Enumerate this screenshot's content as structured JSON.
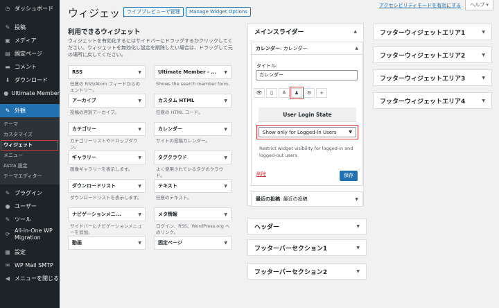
{
  "sidebar": {
    "dashboard": {
      "icon": "◷",
      "label": "ダッシュボード"
    },
    "posts": {
      "icon": "✎",
      "label": "投稿"
    },
    "media": {
      "icon": "▣",
      "label": "メディア"
    },
    "pages": {
      "icon": "▤",
      "label": "固定ページ"
    },
    "comments": {
      "icon": "▬",
      "label": "コメント"
    },
    "download": {
      "icon": "⬇",
      "label": "ダウンロード"
    },
    "um": {
      "icon": "●",
      "label": "Ultimate Member"
    },
    "appearance": {
      "icon": "✎",
      "label": "外観"
    },
    "sub": {
      "theme": "テーマ",
      "customize": "カスタマイズ",
      "widgets": "ウィジェット",
      "menus": "メニュー",
      "astra": "Astra 設定",
      "theme_editor": "テーマエディター"
    },
    "plugins": {
      "icon": "✎",
      "label": "プラグイン"
    },
    "users": {
      "icon": "●",
      "label": "ユーザー"
    },
    "tools": {
      "icon": "✎",
      "label": "ツール"
    },
    "aiowpm": {
      "icon": "⟳",
      "label1": "All-in-One WP",
      "label2": "Migration"
    },
    "settings": {
      "icon": "▦",
      "label": "設定"
    },
    "smtp": {
      "icon": "✉",
      "label": "WP Mail SMTP"
    },
    "collapse": {
      "icon": "◀",
      "label": "メニューを閉じる"
    }
  },
  "screen": {
    "a11y": "アクセシビリティモードを有効にする",
    "help": "ヘルプ ▾"
  },
  "header": {
    "title": "ウィジェット",
    "live_preview": "ライブプレビューで管理",
    "manage": "Manage Widget Options"
  },
  "available": {
    "title": "利用できるウィジェット",
    "desc": "ウィジェットを有効化するにはサイドバーにドラッグするかクリックしてください。ウィジェットを無効化し設定を削除したい場合は、ドラッグして元の場所に戻してください。",
    "widgets": [
      {
        "name": "RSS",
        "desc": "任意の RSS/Atom フィードからのエントリー。"
      },
      {
        "name": "Ultimate Member - ...",
        "desc": "Shows the search member form."
      },
      {
        "name": "アーカイブ",
        "desc": "投稿の月別アーカイブ。"
      },
      {
        "name": "カスタム HTML",
        "desc": "任意の HTML コード。"
      },
      {
        "name": "カテゴリー",
        "desc": "カテゴリーリストやドロップダウン。"
      },
      {
        "name": "カレンダー",
        "desc": "サイトの投稿カレンダー。"
      },
      {
        "name": "ギャラリー",
        "desc": "画像ギャラリーを表示します。"
      },
      {
        "name": "タグクラウド",
        "desc": "よく使用されているタグのクラウド。"
      },
      {
        "name": "ダウンロードリスト",
        "desc": "ダウンロードリストを表示します。"
      },
      {
        "name": "テキスト",
        "desc": "任意のテキスト。"
      },
      {
        "name": "ナビゲーションメニ...",
        "desc": "サイドバーにナビゲーションメニューを追加。"
      },
      {
        "name": "メタ情報",
        "desc": "ログイン、RSS、WordPress.org へのリンク。"
      },
      {
        "name": "動画",
        "desc": ""
      },
      {
        "name": "固定ページ",
        "desc": ""
      }
    ]
  },
  "main_slider": {
    "title": "メインスライダー",
    "widget_name": "カレンダー",
    "widget_sub": ": カレンダー",
    "title_label": "タイトル:",
    "title_value": "カレンダー",
    "tabs": [
      "👁",
      "▯",
      "≛",
      "♟",
      "⚙",
      "+"
    ],
    "uls_header": "User Login State",
    "select_value": "Show only for Logged-In Users",
    "help": "Restrict widget visibility for logged-in and logged-out users.",
    "delete": "削除",
    "save": "保存",
    "recent_name": "最近の投稿",
    "recent_sub": ": 最近の投稿"
  },
  "areas": {
    "header": "ヘッダー",
    "footer_bar1": "フッターバーセクション1",
    "footer_bar2": "フッターバーセクション2",
    "footer1": "フッターウィジェットエリア1",
    "footer2": "フッターウィジェットエリア2",
    "footer3": "フッターウィジェットエリア3",
    "footer4": "フッターウィジェットエリア4"
  },
  "caret_up": "▲",
  "caret_down": "▼"
}
